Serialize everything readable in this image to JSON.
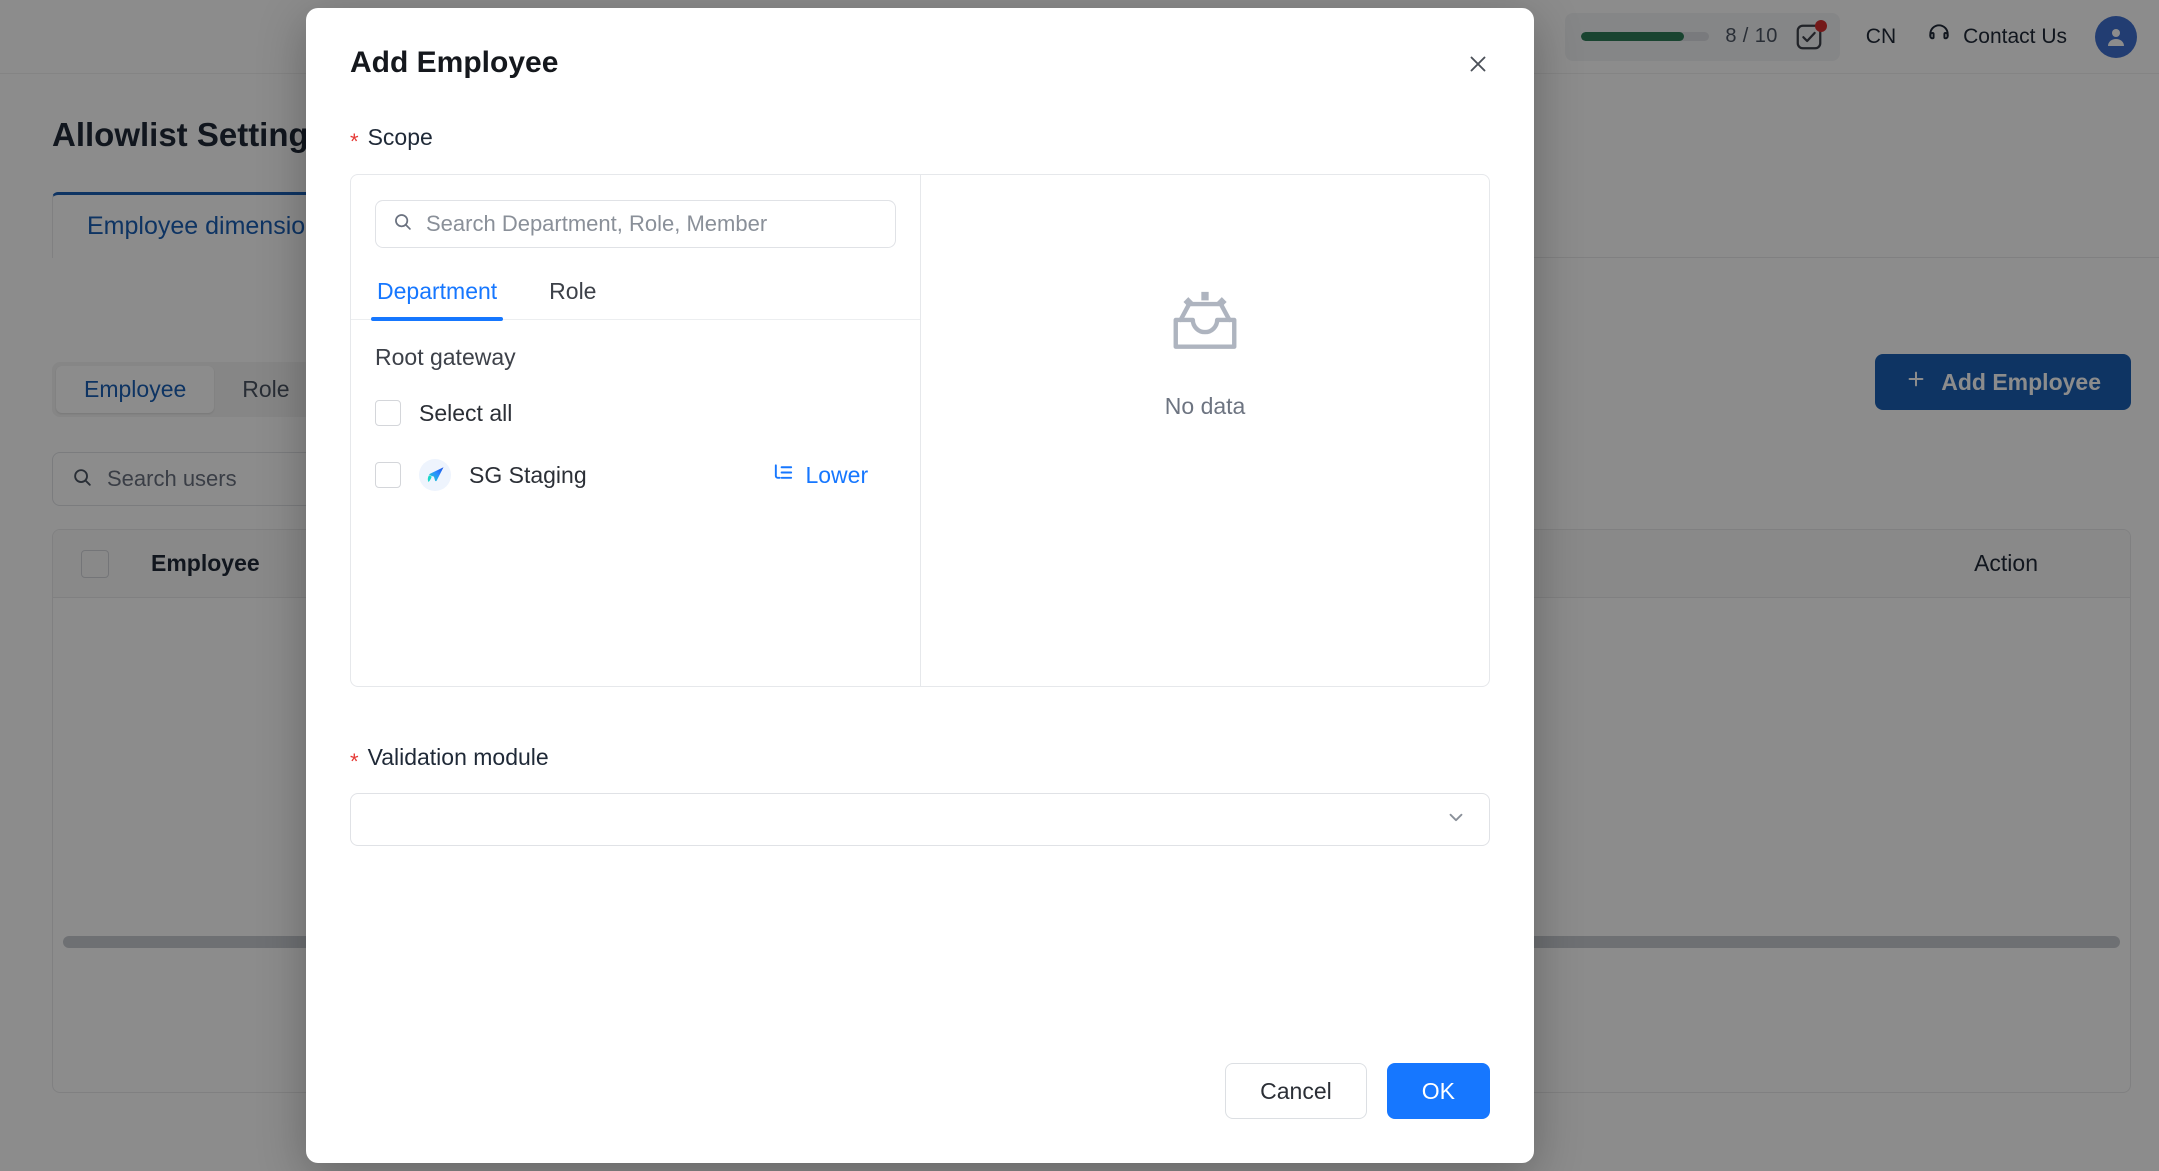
{
  "topbar": {
    "quota": {
      "text": "8 / 10",
      "percent": 80,
      "fill_color": "#2e7d58",
      "track_color": "#dcdfe3"
    },
    "task_icon": "checkbox-task-icon",
    "task_badge": true,
    "language": "CN",
    "contact_icon": "headset-icon",
    "contact_label": "Contact Us",
    "avatar_icon": "user-avatar-icon"
  },
  "background": {
    "page_title": "Allowlist Settings",
    "tab_label": "Employee dimension",
    "segmented": [
      {
        "label": "Employee",
        "active": true
      },
      {
        "label": "Role",
        "active": false
      }
    ],
    "search": {
      "placeholder": "Search users",
      "value": "",
      "icon": "search-icon"
    },
    "table": {
      "columns": [
        "Employee",
        "Action"
      ],
      "rows": []
    },
    "add_button": {
      "label": "Add Employee",
      "icon": "plus-icon",
      "color": "#1a5fb4"
    }
  },
  "modal": {
    "title": "Add Employee",
    "close_icon": "close-icon",
    "scope": {
      "label": "Scope",
      "required": true,
      "search": {
        "placeholder": "Search Department, Role, Member",
        "value": "",
        "icon": "search-icon"
      },
      "tabs": [
        {
          "label": "Department",
          "active": true
        },
        {
          "label": "Role",
          "active": false
        }
      ],
      "tree": {
        "title": "Root gateway",
        "select_all": {
          "label": "Select all",
          "checked": false
        },
        "nodes": [
          {
            "label": "SG Staging",
            "checked": false,
            "logo": "sg-staging-logo-icon",
            "action": {
              "label": "Lower",
              "icon": "hierarchy-list-icon"
            }
          }
        ]
      },
      "empty": {
        "icon": "empty-inbox-icon",
        "label": "No data"
      }
    },
    "validation_module": {
      "label": "Validation module",
      "required": true,
      "value": "",
      "icon": "chevron-down-icon"
    },
    "footer": {
      "cancel_label": "Cancel",
      "ok_label": "OK",
      "ok_color": "#1677ff"
    }
  }
}
